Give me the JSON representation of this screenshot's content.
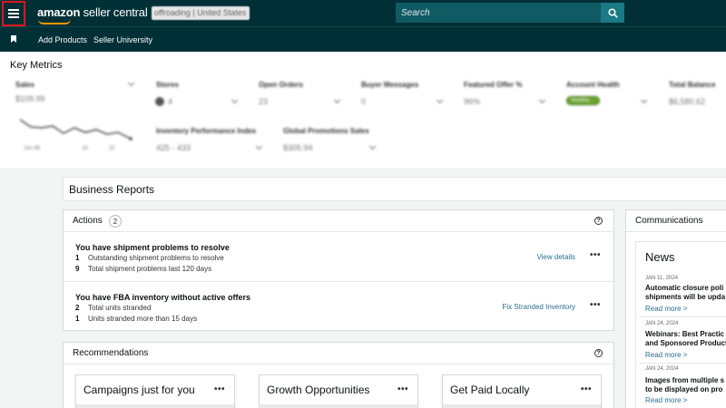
{
  "topbar": {
    "logo_prefix": "amazon",
    "logo_suffix": " seller central",
    "store_label": "offroading | United States",
    "search_placeholder": "Search"
  },
  "subnav": {
    "items": [
      "Add Products",
      "Seller University"
    ]
  },
  "key_metrics": {
    "title": "Key Metrics",
    "sales": {
      "label": "Sales",
      "value": "$109.99",
      "ticks": [
        "Jun 08",
        "15",
        "22"
      ]
    },
    "stores": {
      "label": "Stores",
      "value": "4"
    },
    "open_orders": {
      "label": "Open Orders",
      "value": "23"
    },
    "buyer_messages": {
      "label": "Buyer Messages",
      "value": "0"
    },
    "featured_offer": {
      "label": "Featured Offer %",
      "value": "96%"
    },
    "account_health": {
      "label": "Account Health",
      "value": "Healthy"
    },
    "total_balance": {
      "label": "Total Balance",
      "value": "$6,580.62"
    },
    "inventory_performance": {
      "label": "Inventory Performance Index",
      "value": "425 - 433"
    },
    "global_promotions": {
      "label": "Global Promotions Sales",
      "value": "$305.94"
    }
  },
  "business_reports": {
    "title": "Business Reports"
  },
  "actions": {
    "title": "Actions",
    "count": "2",
    "items": [
      {
        "title": "You have shipment problems to resolve",
        "rows": [
          {
            "n": "1",
            "text": "Outstanding shipment problems to resolve"
          },
          {
            "n": "9",
            "text": "Total shipment problems last 120 days"
          }
        ],
        "cta": "View details"
      },
      {
        "title": "You have FBA inventory without active offers",
        "rows": [
          {
            "n": "2",
            "text": "Total units stranded"
          },
          {
            "n": "1",
            "text": "Units stranded more than 15 days"
          }
        ],
        "cta": "Fix Stranded Inventory"
      }
    ]
  },
  "recommendations": {
    "title": "Recommendations",
    "cards": [
      "Campaigns just for you",
      "Growth Opportunities",
      "Get Paid Locally"
    ]
  },
  "communications": {
    "title": "Communications",
    "news_title": "News",
    "items": [
      {
        "date": "JAN 11, 2024",
        "lines": [
          "Automatic closure poli",
          "shipments will be upda"
        ],
        "link": "Read more >"
      },
      {
        "date": "JAN 24, 2024",
        "lines": [
          "Webinars: Best Practic",
          "and Sponsored Product"
        ],
        "link": "Read more >"
      },
      {
        "date": "JAN 24, 2024",
        "lines": [
          "Images from multiple s",
          "to be displayed on pro"
        ],
        "link": "Read more >"
      }
    ]
  },
  "icons": {
    "menu": "hamburger-menu-icon",
    "search": "search-icon",
    "bookmark": "bookmark-icon",
    "help": "help-circle-icon",
    "more": "more-options-icon"
  },
  "colors": {
    "header_bg": "#002f36",
    "search_bg": "#0f5a63",
    "search_button": "#1a7a85",
    "highlight_border": "#e3141c",
    "link": "#2a6f91",
    "health_pill": "#6aa22e"
  }
}
